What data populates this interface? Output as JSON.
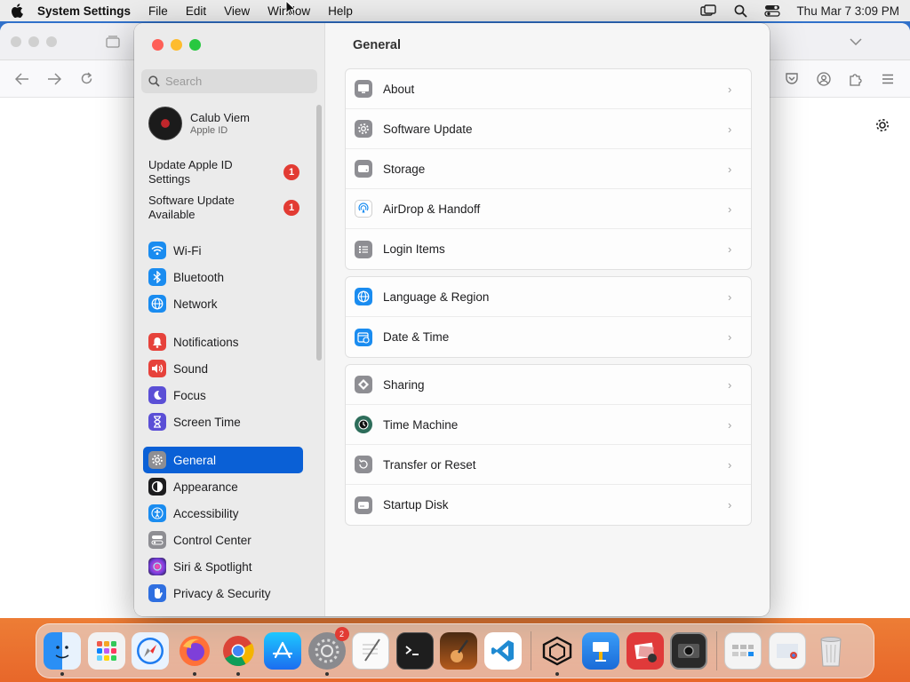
{
  "menubar": {
    "app_name": "System Settings",
    "items": [
      "File",
      "Edit",
      "View",
      "Window",
      "Help"
    ],
    "clock": "Thu Mar 7  3:09 PM"
  },
  "settings": {
    "search_placeholder": "Search",
    "profile": {
      "name": "Calub Viem",
      "subtitle": "Apple ID"
    },
    "notices": [
      {
        "label": "Update Apple ID Settings",
        "badge": "1"
      },
      {
        "label": "Software Update Available",
        "badge": "1"
      }
    ],
    "sidebar": [
      {
        "label": "Wi-Fi",
        "icon": "wifi-icon",
        "color": "#1a8cf0"
      },
      {
        "label": "Bluetooth",
        "icon": "bluetooth-icon",
        "color": "#1a8cf0"
      },
      {
        "label": "Network",
        "icon": "globe-icon",
        "color": "#1a8cf0"
      },
      {
        "label": "Notifications",
        "icon": "bell-icon",
        "color": "#e6423b"
      },
      {
        "label": "Sound",
        "icon": "speaker-icon",
        "color": "#e6423b"
      },
      {
        "label": "Focus",
        "icon": "moon-icon",
        "color": "#5b4fd6"
      },
      {
        "label": "Screen Time",
        "icon": "hourglass-icon",
        "color": "#5b4fd6"
      },
      {
        "label": "General",
        "icon": "gear-icon",
        "color": "#8e8e93"
      },
      {
        "label": "Appearance",
        "icon": "appearance-icon",
        "color": "#1c1c1e"
      },
      {
        "label": "Accessibility",
        "icon": "accessibility-icon",
        "color": "#1a8cf0"
      },
      {
        "label": "Control Center",
        "icon": "control-center-icon",
        "color": "#8e8e93"
      },
      {
        "label": "Siri & Spotlight",
        "icon": "siri-icon",
        "color": "#8a3fd1"
      },
      {
        "label": "Privacy & Security",
        "icon": "hand-icon",
        "color": "#2f6fe0"
      }
    ],
    "title": "General",
    "groups": [
      [
        {
          "label": "About",
          "icon": "display-icon",
          "color": "#8e8e93"
        },
        {
          "label": "Software Update",
          "icon": "gear-badge-icon",
          "color": "#8e8e93"
        },
        {
          "label": "Storage",
          "icon": "drive-icon",
          "color": "#8e8e93"
        },
        {
          "label": "AirDrop & Handoff",
          "icon": "airdrop-icon",
          "color": "#1a8cf0"
        },
        {
          "label": "Login Items",
          "icon": "list-icon",
          "color": "#8e8e93"
        }
      ],
      [
        {
          "label": "Language & Region",
          "icon": "globe-icon",
          "color": "#1a8cf0"
        },
        {
          "label": "Date & Time",
          "icon": "calendar-clock-icon",
          "color": "#1a8cf0"
        }
      ],
      [
        {
          "label": "Sharing",
          "icon": "sharing-icon",
          "color": "#8e8e93"
        },
        {
          "label": "Time Machine",
          "icon": "time-machine-icon",
          "color": "#2d6d5a"
        },
        {
          "label": "Transfer or Reset",
          "icon": "reset-icon",
          "color": "#8e8e93"
        },
        {
          "label": "Startup Disk",
          "icon": "disk-icon",
          "color": "#8e8e93"
        }
      ]
    ]
  },
  "dock": {
    "apps": [
      "Finder",
      "Launchpad",
      "Safari",
      "Firefox",
      "Chrome",
      "App Store",
      "System Settings",
      "TextEdit",
      "Terminal",
      "GarageBand",
      "VS Code"
    ],
    "apps2": [
      "Cube",
      "Keynote",
      "Photo Booth",
      "Screen Capture"
    ],
    "apps3": [
      "Downloads Stack",
      "Documents Stack",
      "Trash"
    ],
    "settings_badge": "2"
  }
}
